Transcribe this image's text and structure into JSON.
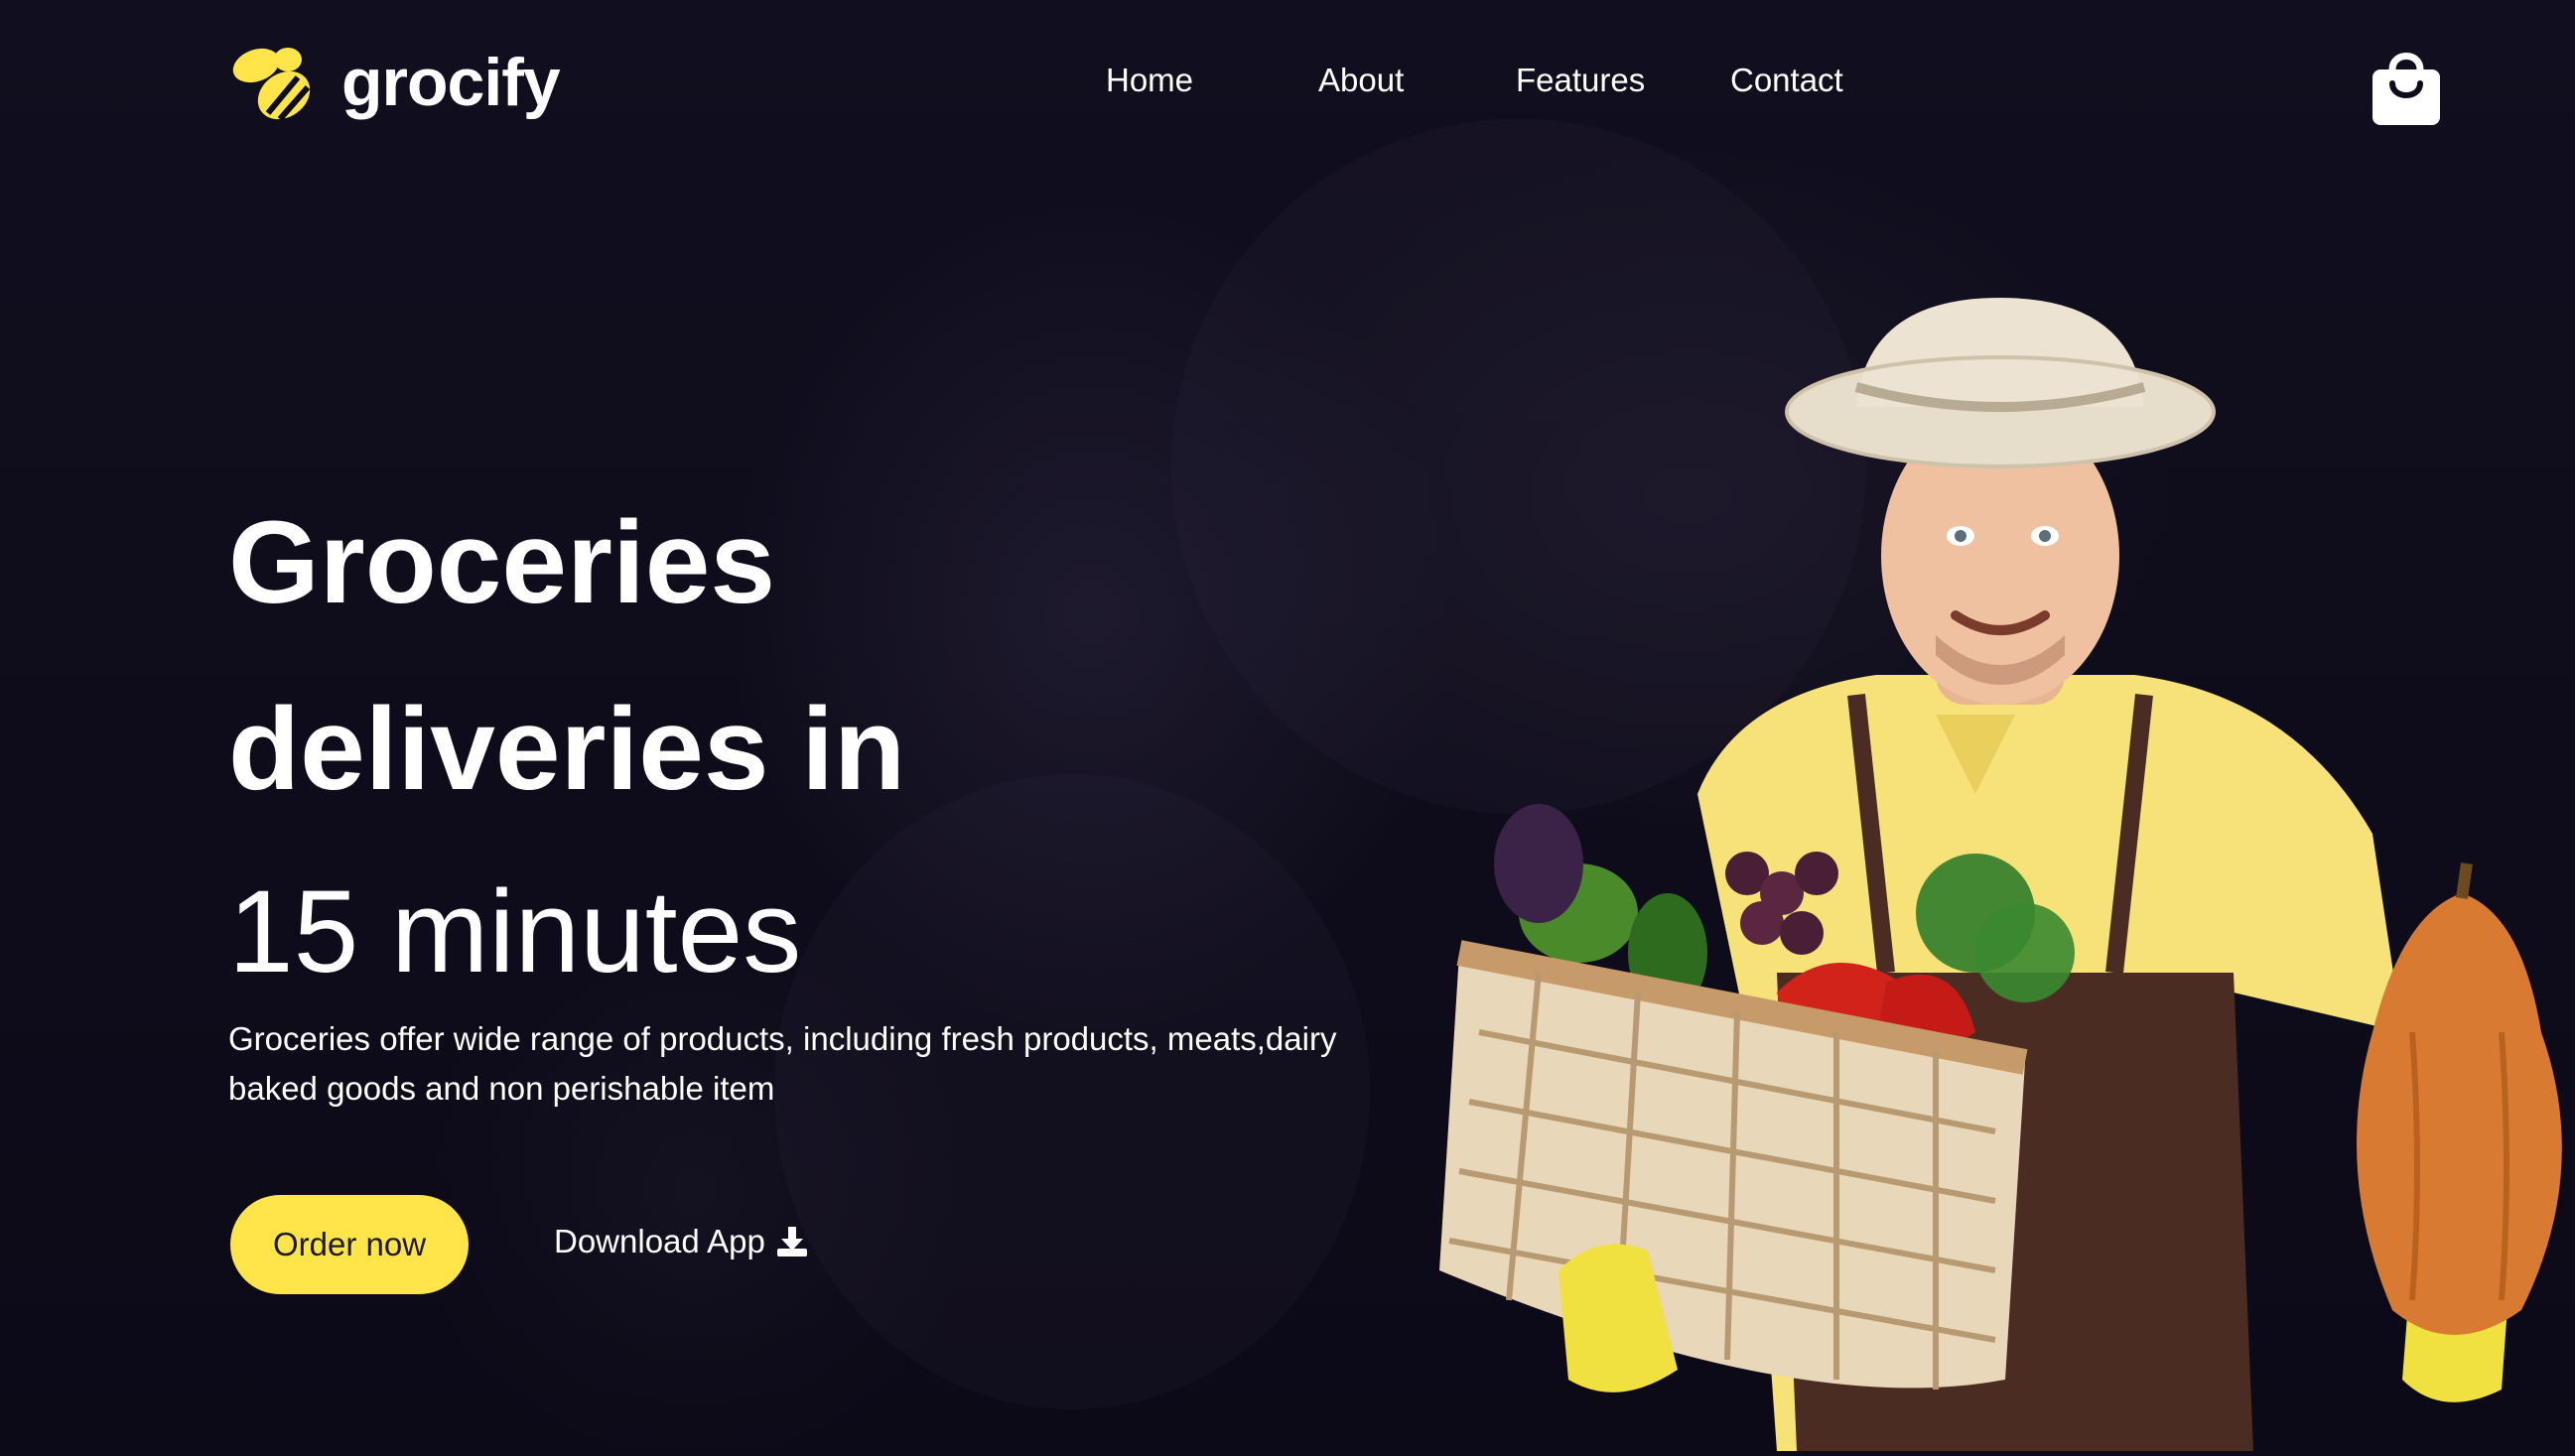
{
  "brand": {
    "name": "grocify",
    "logo_icon": "bee-icon",
    "accent_color": "#ffe54a"
  },
  "nav": {
    "items": [
      {
        "label": "Home"
      },
      {
        "label": "About"
      },
      {
        "label": "Features"
      },
      {
        "label": "Contact"
      }
    ],
    "cart_icon": "shopping-bag-icon"
  },
  "hero": {
    "title_line1": "Groceries",
    "title_line2": "deliveries in",
    "title_line3": "15 minutes",
    "description": "Groceries offer wide range of products, including fresh products, meats,dairy baked goods and non perishable item",
    "primary_button": "Order now",
    "secondary_button": "Download App",
    "secondary_icon": "download-icon",
    "image": "farmer-with-vegetable-basket"
  },
  "colors": {
    "background": "#0e0c1a",
    "button_bg": "#ffe54a",
    "button_text": "#1b1a22",
    "text": "#ffffff"
  }
}
